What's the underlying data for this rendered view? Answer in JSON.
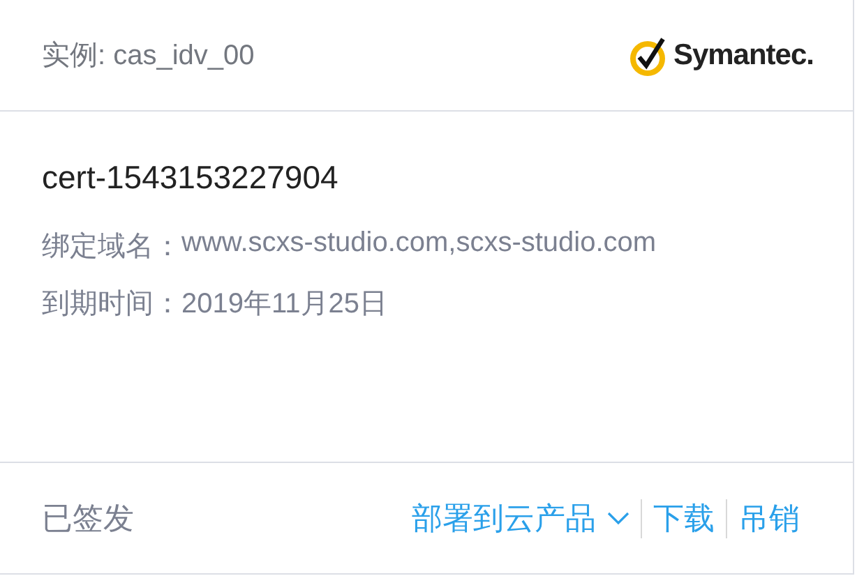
{
  "header": {
    "instance": "实例: cas_idv_00",
    "brand": "Symantec."
  },
  "cert": {
    "name": "cert-1543153227904",
    "fields": [
      {
        "label": "绑定域名：",
        "value": "www.scxs-studio.com,scxs-studio.com"
      },
      {
        "label": "到期时间：",
        "value": "2019年11月25日"
      }
    ]
  },
  "footer": {
    "status": "已签发",
    "actions": [
      {
        "label": "部署到云产品",
        "kind": "dropdown"
      },
      {
        "label": "下载",
        "kind": "link"
      },
      {
        "label": "吊销",
        "kind": "link"
      }
    ]
  }
}
